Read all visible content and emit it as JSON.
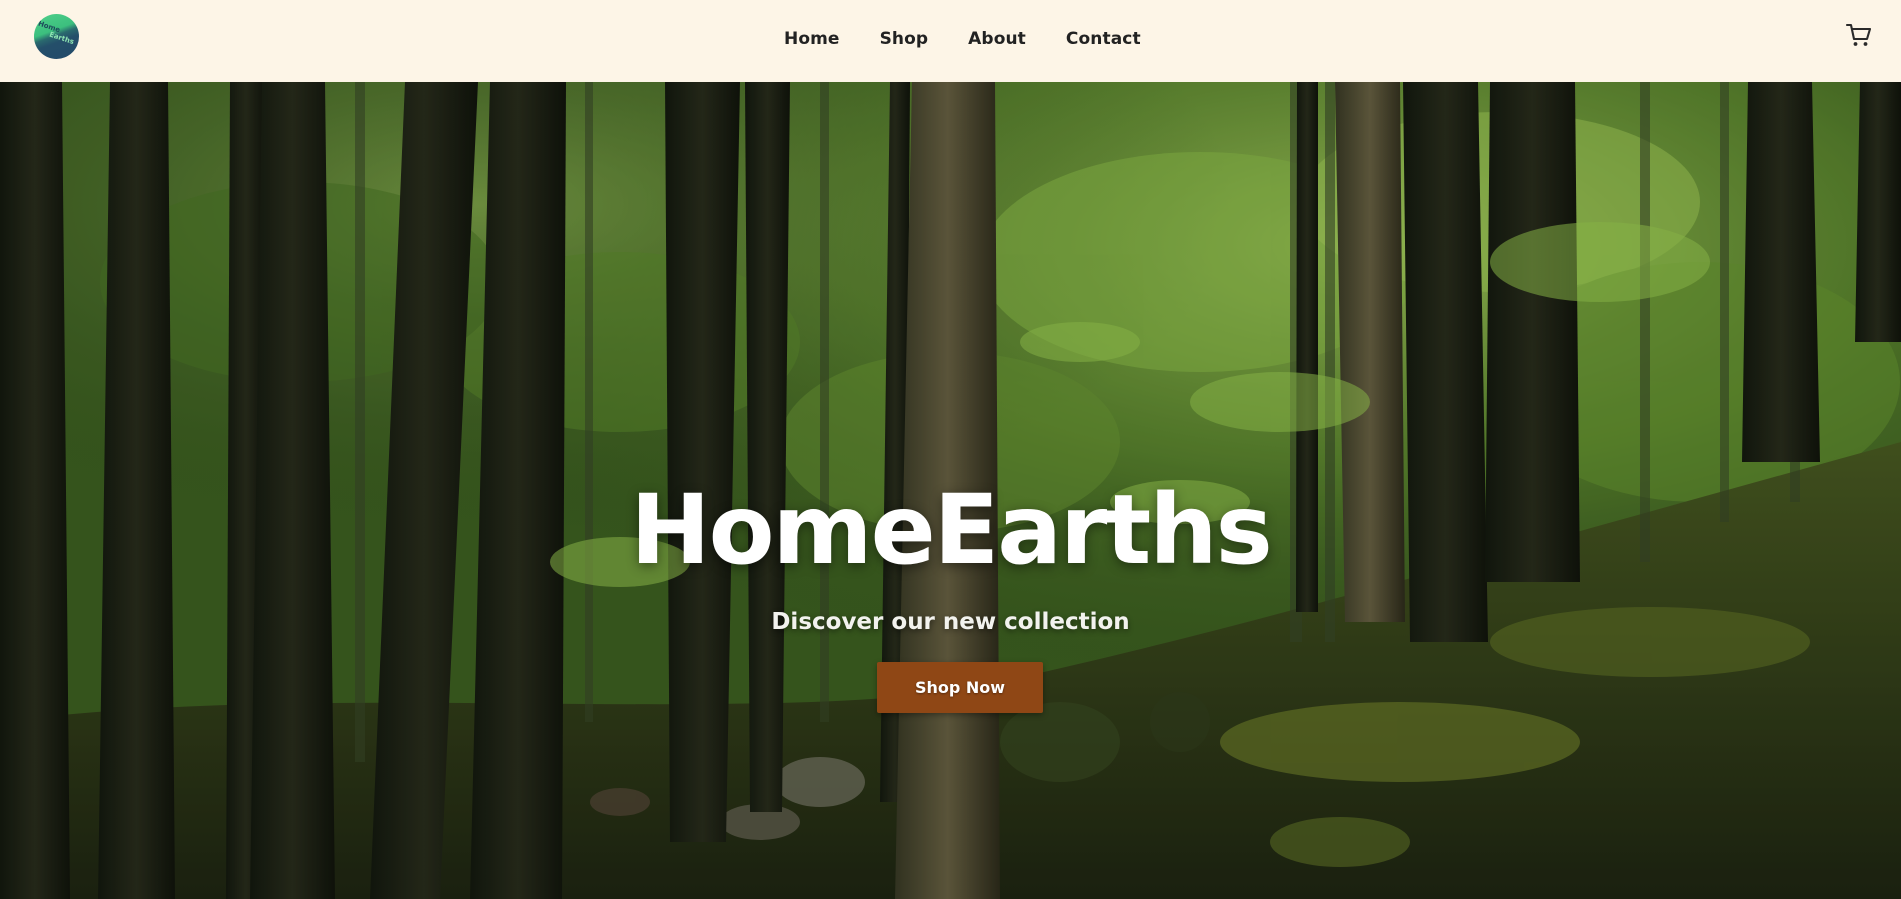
{
  "brand": {
    "logo_text_line1": "Home",
    "logo_text_line2": "Earths"
  },
  "nav": {
    "items": [
      {
        "label": "Home"
      },
      {
        "label": "Shop"
      },
      {
        "label": "About"
      },
      {
        "label": "Contact"
      }
    ]
  },
  "header": {
    "cart_icon": "shopping-cart-icon"
  },
  "hero": {
    "title": "HomeEarths",
    "subtitle": "Discover our new collection",
    "cta_label": "Shop Now",
    "background": "forest-photo"
  },
  "colors": {
    "header_bg": "#fdf5e7",
    "cta_bg": "#8f4715",
    "nav_text": "#222222",
    "hero_text": "#ffffff"
  }
}
